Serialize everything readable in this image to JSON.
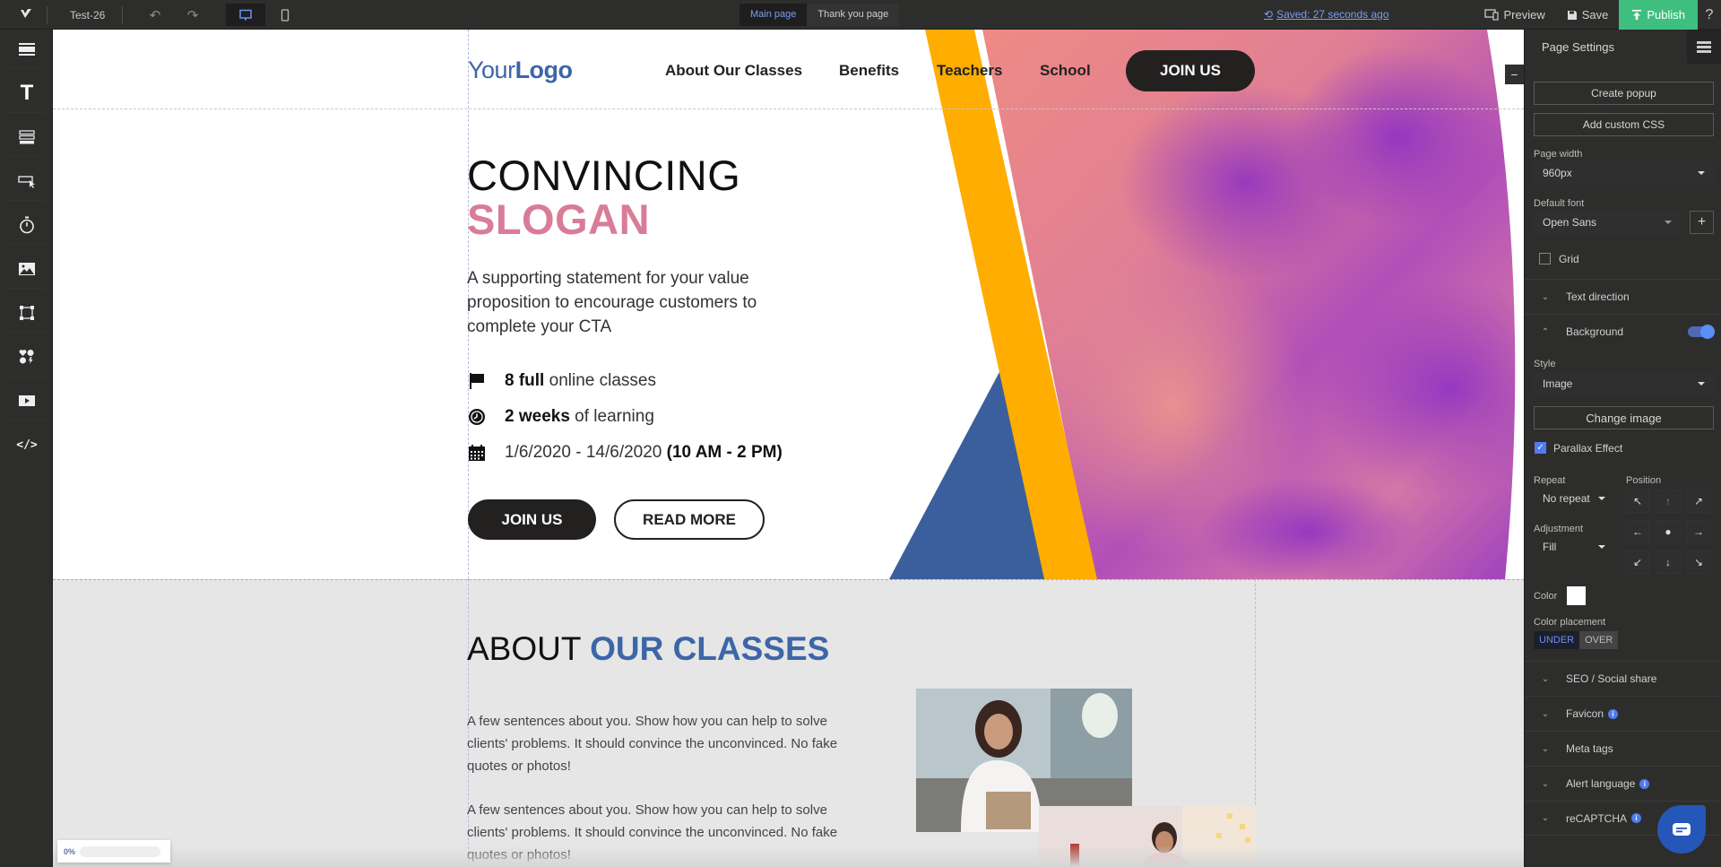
{
  "topbar": {
    "project_title": "Test-26",
    "page_tabs": [
      {
        "label": "Main page",
        "active": true
      },
      {
        "label": "Thank you page",
        "active": false
      }
    ],
    "saved_status": "Saved: 27 seconds ago",
    "preview_label": "Preview",
    "save_label": "Save",
    "publish_label": "Publish",
    "help_label": "?"
  },
  "toolbar": {
    "tools": [
      "section-icon",
      "text-icon",
      "form-icon",
      "button-icon",
      "timer-icon",
      "image-icon",
      "box-icon",
      "social-icons-icon",
      "video-icon",
      "code-icon"
    ]
  },
  "page": {
    "nav": {
      "logo_light": "Your",
      "logo_bold": "Logo",
      "links": [
        "About Our Classes",
        "Benefits",
        "Teachers",
        "School"
      ],
      "cta": "JOIN US"
    },
    "hero": {
      "title_line1": "CONVINCING",
      "title_line2": "SLOGAN",
      "support_text": "A supporting statement for your value proposition to encourage customers to complete your CTA",
      "features": [
        {
          "icon": "flag-icon",
          "bold": "8 full",
          "rest": " online classes"
        },
        {
          "icon": "clock-icon",
          "bold": "2 weeks",
          "rest": " of learning"
        },
        {
          "icon": "calendar-icon",
          "pre": "1/6/2020 - 14/6/2020 ",
          "bold": "(10 AM - 2 PM)"
        }
      ],
      "join_label": "JOIN US",
      "read_more_label": "READ MORE"
    },
    "about": {
      "title_light": "ABOUT ",
      "title_bold": "OUR CLASSES",
      "paragraphs": [
        "A few sentences about you. Show how you can help to solve clients' problems. It should convince the unconvinced. No fake quotes or photos!",
        "A few sentences about you. Show how you can help to solve clients' problems. It should convince the unconvinced. No fake quotes or photos!"
      ]
    },
    "progress_label": "0%",
    "colors": {
      "brand_blue": "#3d66a8",
      "slogan_pink": "#d97c98",
      "accent_yellow": "#ffad00",
      "dark": "#232020"
    }
  },
  "settings": {
    "title": "Page Settings",
    "create_popup": "Create popup",
    "add_css": "Add custom CSS",
    "page_width_label": "Page width",
    "page_width_value": "960px",
    "default_font_label": "Default font",
    "default_font_value": "Open Sans",
    "grid_label": "Grid",
    "grid_checked": false,
    "text_direction": "Text direction",
    "background": "Background",
    "background_enabled": true,
    "style_label": "Style",
    "style_value": "Image",
    "change_image": "Change image",
    "parallax_label": "Parallax Effect",
    "parallax_checked": true,
    "repeat_label": "Repeat",
    "repeat_value": "No repeat",
    "position_label": "Position",
    "position_selected": "top-center",
    "adjustment_label": "Adjustment",
    "adjustment_value": "Fill",
    "color_label": "Color",
    "color_value": "#ffffff",
    "color_placement_label": "Color placement",
    "placement_under": "UNDER",
    "placement_over": "OVER",
    "placement_selected": "UNDER",
    "sections": [
      {
        "label": "SEO / Social share",
        "info": false
      },
      {
        "label": "Favicon",
        "info": true
      },
      {
        "label": "Meta tags",
        "info": false
      },
      {
        "label": "Alert language",
        "info": true
      },
      {
        "label": "reCAPTCHA",
        "info": true
      }
    ]
  }
}
